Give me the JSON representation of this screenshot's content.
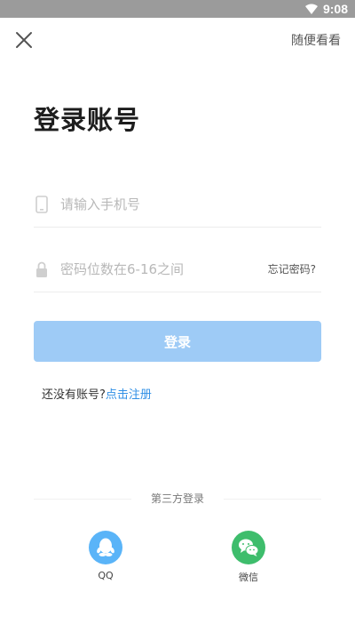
{
  "status_bar": {
    "time": "9:08",
    "wifi_icon": "wifi-icon"
  },
  "header": {
    "close_icon": "close-icon",
    "browse_label": "随便看看"
  },
  "title": "登录账号",
  "phone": {
    "placeholder": "请输入手机号",
    "value": "",
    "icon": "phone-icon"
  },
  "password": {
    "placeholder": "密码位数在6-16之间",
    "value": "",
    "icon": "lock-icon",
    "forgot_label": "忘记密码?"
  },
  "login_button": "登录",
  "register": {
    "prompt": "还没有账号?",
    "link": "点击注册"
  },
  "third_party": {
    "label": "第三方登录",
    "providers": [
      {
        "name": "QQ",
        "icon": "qq-icon",
        "color": "#5ab4f8"
      },
      {
        "name": "微信",
        "icon": "wechat-icon",
        "color": "#3ebd6c"
      }
    ]
  },
  "colors": {
    "login_button": "#9ecbf6",
    "link": "#2f8fe6"
  }
}
